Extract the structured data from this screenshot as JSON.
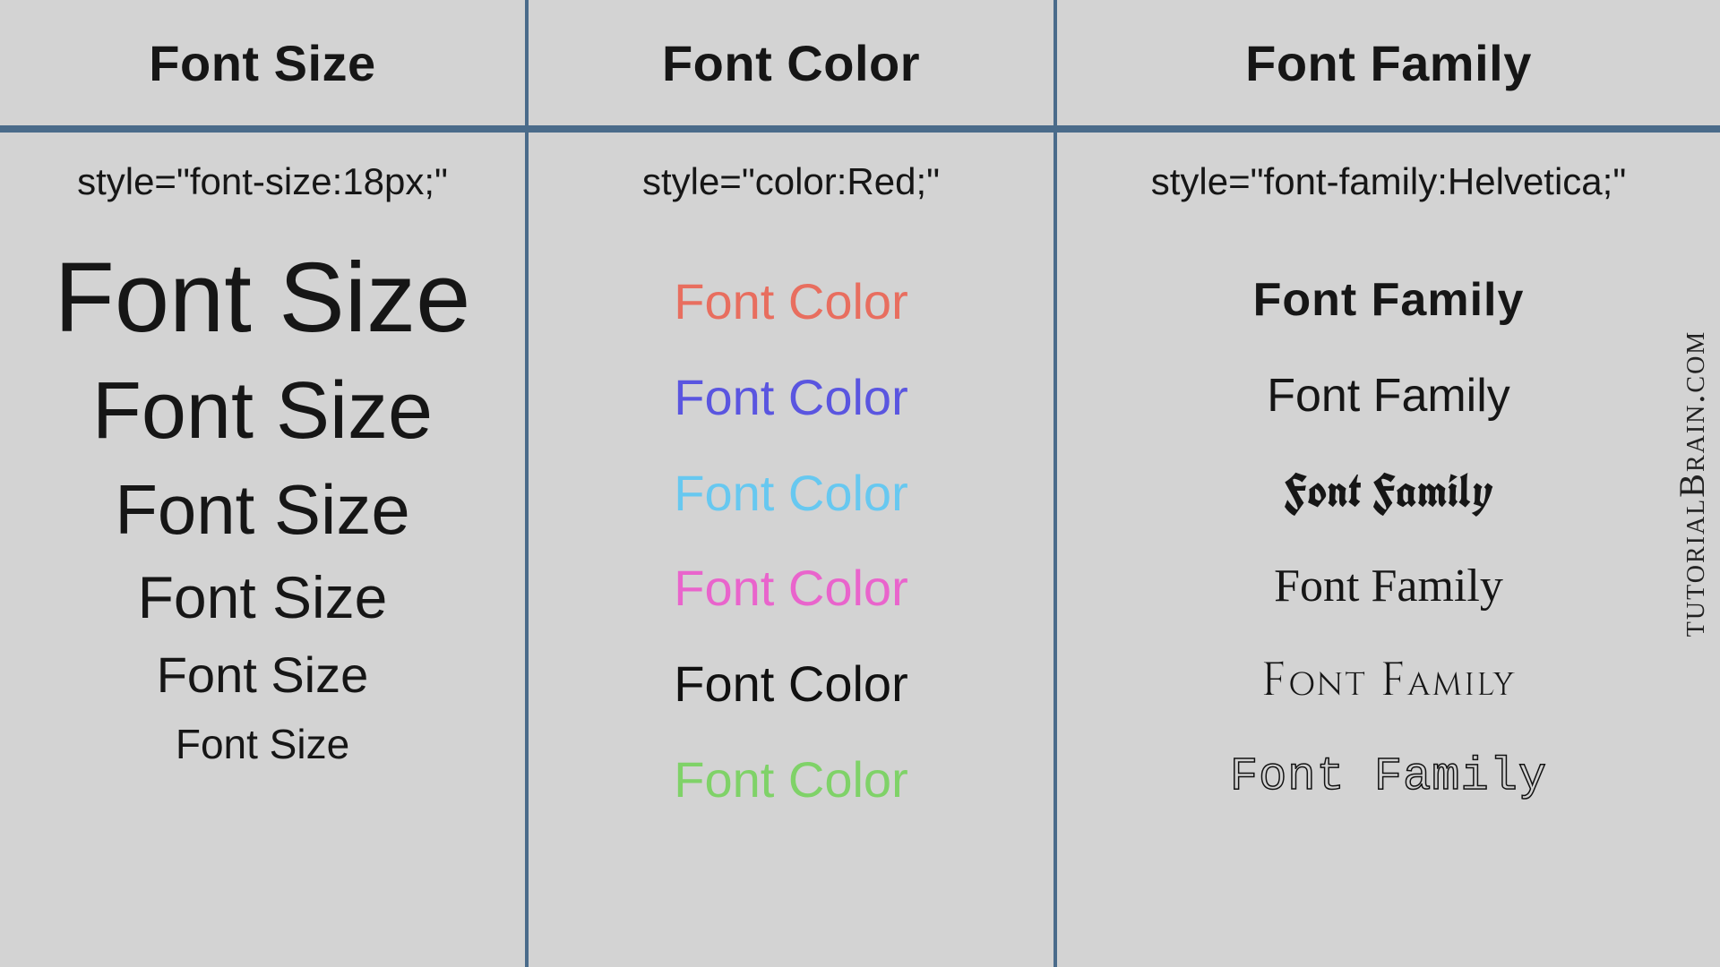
{
  "columns": {
    "size": {
      "header": "Font Size",
      "code": "style=\"font-size:18px;\"",
      "samples": [
        "Font Size",
        "Font Size",
        "Font Size",
        "Font Size",
        "Font Size",
        "Font Size"
      ]
    },
    "color": {
      "header": "Font Color",
      "code": "style=\"color:Red;\"",
      "samples": [
        {
          "text": "Font Color",
          "color": "#e86e5f"
        },
        {
          "text": "Font Color",
          "color": "#5a55e0"
        },
        {
          "text": "Font Color",
          "color": "#67c8f0"
        },
        {
          "text": "Font Color",
          "color": "#e964cc"
        },
        {
          "text": "Font Color",
          "color": "#111111"
        },
        {
          "text": "Font Color",
          "color": "#7fd268"
        }
      ]
    },
    "family": {
      "header": "Font Family",
      "code": "style=\"font-family:Helvetica;\"",
      "samples": [
        "Font Family",
        "Font Family",
        "Font Family",
        "Font Family",
        "Font Family",
        "Font Family"
      ]
    }
  },
  "watermark": "tutorialBrain.com"
}
